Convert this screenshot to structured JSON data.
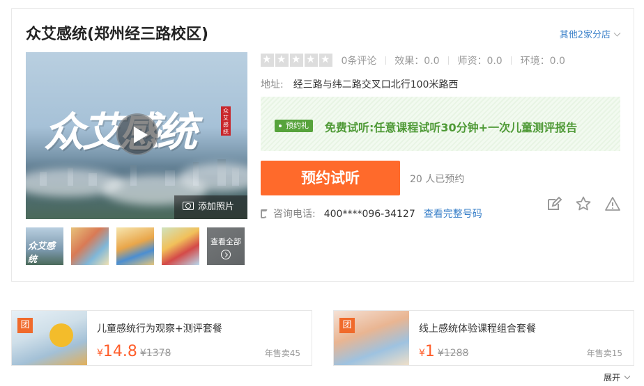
{
  "store": {
    "title": "众艾感统(郑州经三路校区)",
    "branches_label": "其他2家分店"
  },
  "media": {
    "video_caption": "众艾感统",
    "seal_text": "众艾感统",
    "add_photo_label": "添加照片",
    "view_all_label": "查看全部"
  },
  "rating": {
    "stars": 0,
    "reviews": "0条评论",
    "effect": "效果：0.0",
    "teachers": "师资：0.0",
    "environment": "环境：0.0"
  },
  "address": {
    "label": "地址:",
    "value": "经三路与纬二路交叉口北行100米路西"
  },
  "promo": {
    "tag": "预约礼",
    "text": "免费试听:任意课程试听30分钟+一次儿童测评报告",
    "color": "#4f9a37"
  },
  "booking": {
    "button_label": "预约试听",
    "booked_count": "20 人已预约",
    "color": "#ff6a2b"
  },
  "phone": {
    "label": "咨询电话:",
    "number": "400****096-34127",
    "reveal_label": "查看完整号码"
  },
  "deals": [
    {
      "badge": "团",
      "name": "儿童感统行为观察+测评套餐",
      "currency": "¥",
      "price": "14.8",
      "original": "¥1378",
      "sold": "年售卖45"
    },
    {
      "badge": "团",
      "name": "线上感统体验课程组合套餐",
      "currency": "¥",
      "price": "1",
      "original": "¥1288",
      "sold": "年售卖15"
    }
  ],
  "expand_label": "展开"
}
